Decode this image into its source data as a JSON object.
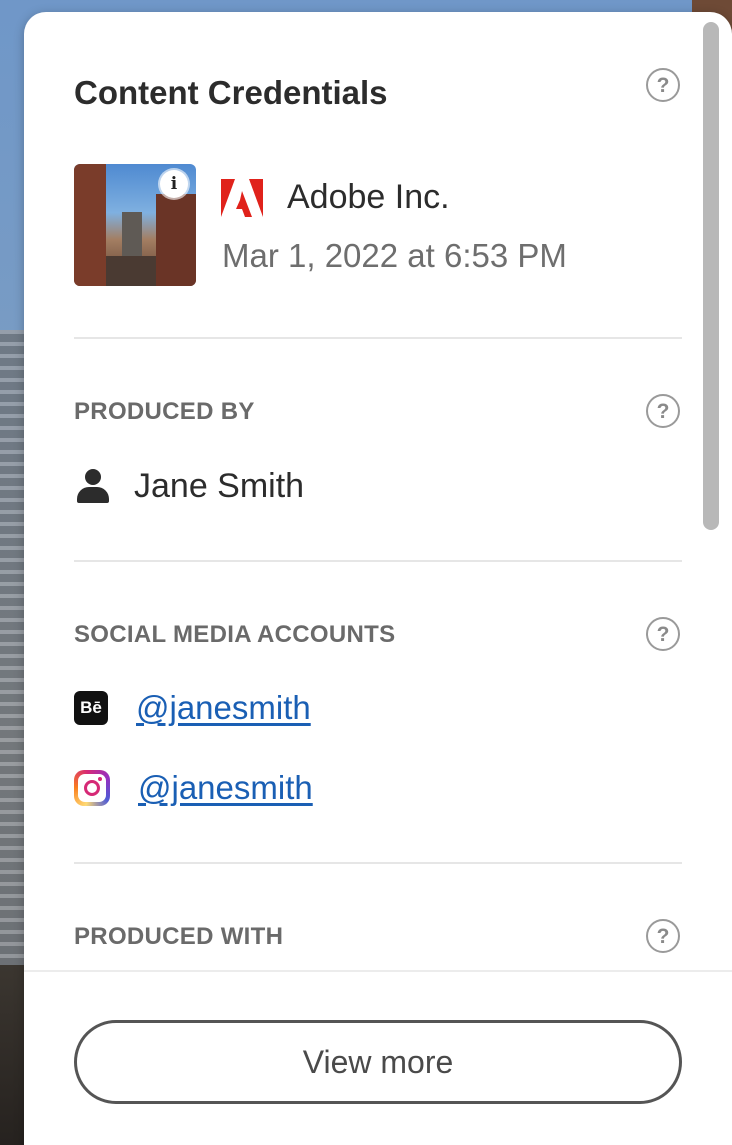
{
  "panel": {
    "title": "Content Credentials",
    "help_glyph": "?"
  },
  "header": {
    "thumbnail_badge": "i",
    "company": "Adobe Inc.",
    "timestamp": "Mar 1, 2022 at 6:53 PM",
    "logo_icon": "adobe-logo",
    "logo_color": "#e0221b"
  },
  "produced_by": {
    "label": "PRODUCED BY",
    "name": "Jane Smith",
    "icon": "person-icon"
  },
  "social_media": {
    "label": "SOCIAL MEDIA ACCOUNTS",
    "accounts": [
      {
        "icon": "behance-icon",
        "icon_text": "Bē",
        "handle": "@janesmith"
      },
      {
        "icon": "instagram-icon",
        "handle": "@janesmith"
      }
    ]
  },
  "produced_with": {
    "label": "PRODUCED WITH"
  },
  "footer": {
    "view_more_label": "View more"
  },
  "colors": {
    "link": "#1a5fb4",
    "section_label": "#6a6a6a"
  }
}
